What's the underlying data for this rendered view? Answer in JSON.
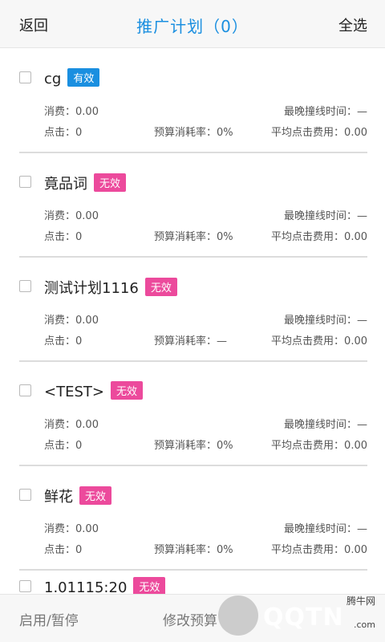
{
  "header": {
    "back_label": "返回",
    "title": "推广计划（0）",
    "select_all_label": "全选"
  },
  "plans": [
    {
      "name": "cg",
      "status": "有效",
      "spend_label": "消费：",
      "spend": "0.00",
      "latest_time_label": "最晚撞线时间：",
      "latest_time": "—",
      "clicks_label": "点击：",
      "clicks": "0",
      "budget_rate_label": "预算消耗率：",
      "budget_rate": "0%",
      "avg_cpc_label": "平均点击费用：",
      "avg_cpc": "0.00"
    },
    {
      "name": "竟品词",
      "status": "无效",
      "spend_label": "消费：",
      "spend": "0.00",
      "latest_time_label": "最晚撞线时间：",
      "latest_time": "—",
      "clicks_label": "点击：",
      "clicks": "0",
      "budget_rate_label": "预算消耗率：",
      "budget_rate": "0%",
      "avg_cpc_label": "平均点击费用：",
      "avg_cpc": "0.00"
    },
    {
      "name": "测试计划1116",
      "status": "无效",
      "spend_label": "消费：",
      "spend": "0.00",
      "latest_time_label": "最晚撞线时间：",
      "latest_time": "—",
      "clicks_label": "点击：",
      "clicks": "0",
      "budget_rate_label": "预算消耗率：",
      "budget_rate": "—",
      "avg_cpc_label": "平均点击费用：",
      "avg_cpc": "0.00"
    },
    {
      "name": "<TEST>",
      "status": "无效",
      "spend_label": "消费：",
      "spend": "0.00",
      "latest_time_label": "最晚撞线时间：",
      "latest_time": "—",
      "clicks_label": "点击：",
      "clicks": "0",
      "budget_rate_label": "预算消耗率：",
      "budget_rate": "0%",
      "avg_cpc_label": "平均点击费用：",
      "avg_cpc": "0.00"
    },
    {
      "name": "鲜花",
      "status": "无效",
      "spend_label": "消费：",
      "spend": "0.00",
      "latest_time_label": "最晚撞线时间：",
      "latest_time": "—",
      "clicks_label": "点击：",
      "clicks": "0",
      "budget_rate_label": "预算消耗率：",
      "budget_rate": "0%",
      "avg_cpc_label": "平均点击费用：",
      "avg_cpc": "0.00"
    }
  ],
  "partial_plan": {
    "name": "1.01115:20",
    "status": "无效"
  },
  "footer": {
    "toggle_label": "启用/暂停",
    "edit_budget_label": "修改预算"
  },
  "watermark": {
    "brand": "QQTN",
    "site_name": "腾牛网",
    "url": ".com"
  },
  "colors": {
    "accent": "#1a8fe0",
    "valid_badge": "#1a8fe0",
    "invalid_badge": "#ec4a9c"
  },
  "icons": {
    "checkbox": "checkbox-icon"
  }
}
